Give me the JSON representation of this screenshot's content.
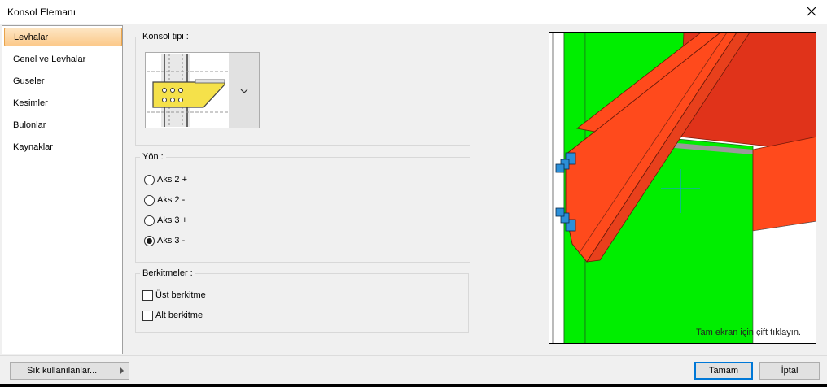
{
  "window": {
    "title": "Konsol Elemanı"
  },
  "sidebar": {
    "items": [
      {
        "label": "Levhalar"
      },
      {
        "label": "Genel ve Levhalar"
      },
      {
        "label": "Guseler"
      },
      {
        "label": "Kesimler"
      },
      {
        "label": "Bulonlar"
      },
      {
        "label": "Kaynaklar"
      }
    ]
  },
  "konsol_tipi": {
    "label": "Konsol tipi :"
  },
  "yon": {
    "label": "Yön :",
    "options": [
      {
        "label": "Aks 2 +",
        "selected": false
      },
      {
        "label": "Aks 2 -",
        "selected": false
      },
      {
        "label": "Aks 3 +",
        "selected": false
      },
      {
        "label": "Aks 3 -",
        "selected": true
      }
    ]
  },
  "berkitmeler": {
    "label": "Berkitmeler :",
    "options": [
      {
        "label": "Üst berkitme",
        "checked": false
      },
      {
        "label": "Alt berkitme",
        "checked": false
      }
    ]
  },
  "viewer": {
    "hint": "Tam ekran için çift tıklayın."
  },
  "footer": {
    "favorites_label": "Sık kullanılanlar...",
    "ok_label": "Tamam",
    "cancel_label": "İptal"
  },
  "colors": {
    "accent": "#0078d7",
    "selection": "#fcc98a",
    "column_green": "#00ee00",
    "beam_orange": "#ff4a1c",
    "bolt_blue": "#2b8fd8",
    "preview_plate": "#f5e14a"
  }
}
